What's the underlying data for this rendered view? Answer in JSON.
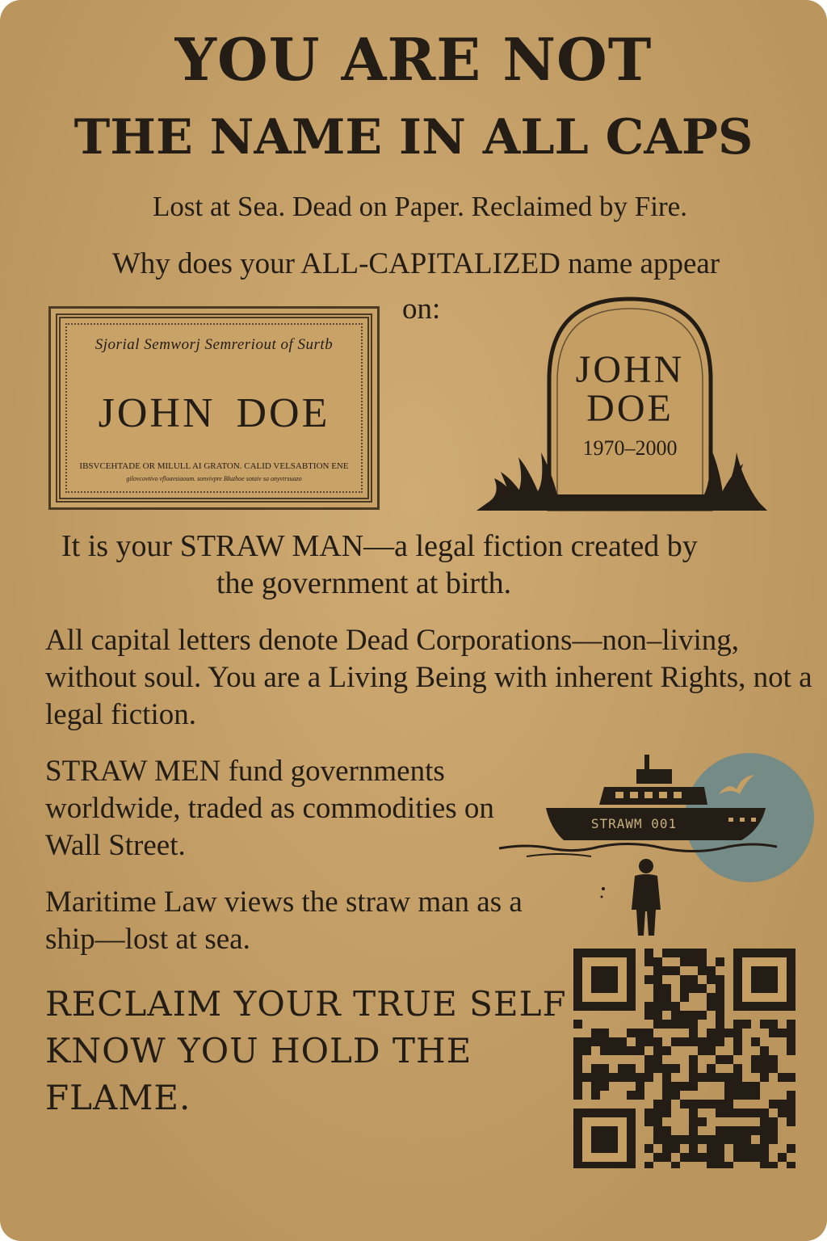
{
  "title": {
    "line1": "YOU ARE NOT",
    "line2": "THE NAME IN ALL CAPS"
  },
  "subtitle": "Lost at Sea. Dead on Paper. Reclaimed by Fire.",
  "question": {
    "line1": "Why does your ALL-CAPITALIZED name appear",
    "line2": "on:"
  },
  "certificate": {
    "heading": "Sjorial Semworj Semreriout of Surtb",
    "name": "JOHN DOE",
    "fine_print": "IBSVCEHTADE OR MILULL AI GRATON. CALID VELSABTION ENE",
    "fine_print2": "gilovcovtivo vfloavsiaoum. sonvivpre Bluzhoe sotaiv sa onyvtrsuazo"
  },
  "tombstone": {
    "line1": "JOHN",
    "line2": "DOE",
    "dates": "1970–2000"
  },
  "straw_man": {
    "line1": "It is your STRAW MAN—a legal fiction created by",
    "line2": "the government at birth."
  },
  "paragraph_corporations": "All capital letters denote Dead Corporations—non–living, without soul. You are a Living Being with inherent Rights, not a legal fiction.",
  "paragraph_fund": "STRAW MEN fund governments worldwide, traded as commodities on Wall Street.",
  "paragraph_maritime": "Maritime Law views the straw man as a ship—lost at sea.",
  "ship": {
    "label": "STRAWM 001"
  },
  "call_to_action": "RECLAIM YOUR TRUE SELF KNOW YOU HOLD THE FLAME.",
  "colors": {
    "background": "#c59e63",
    "ink": "#231d15",
    "moon": "#6f8a8a"
  },
  "icons": [
    "birth-certificate",
    "tombstone-icon",
    "ship-icon",
    "moon-icon",
    "bird-icon",
    "person-icon",
    "qr-code"
  ]
}
